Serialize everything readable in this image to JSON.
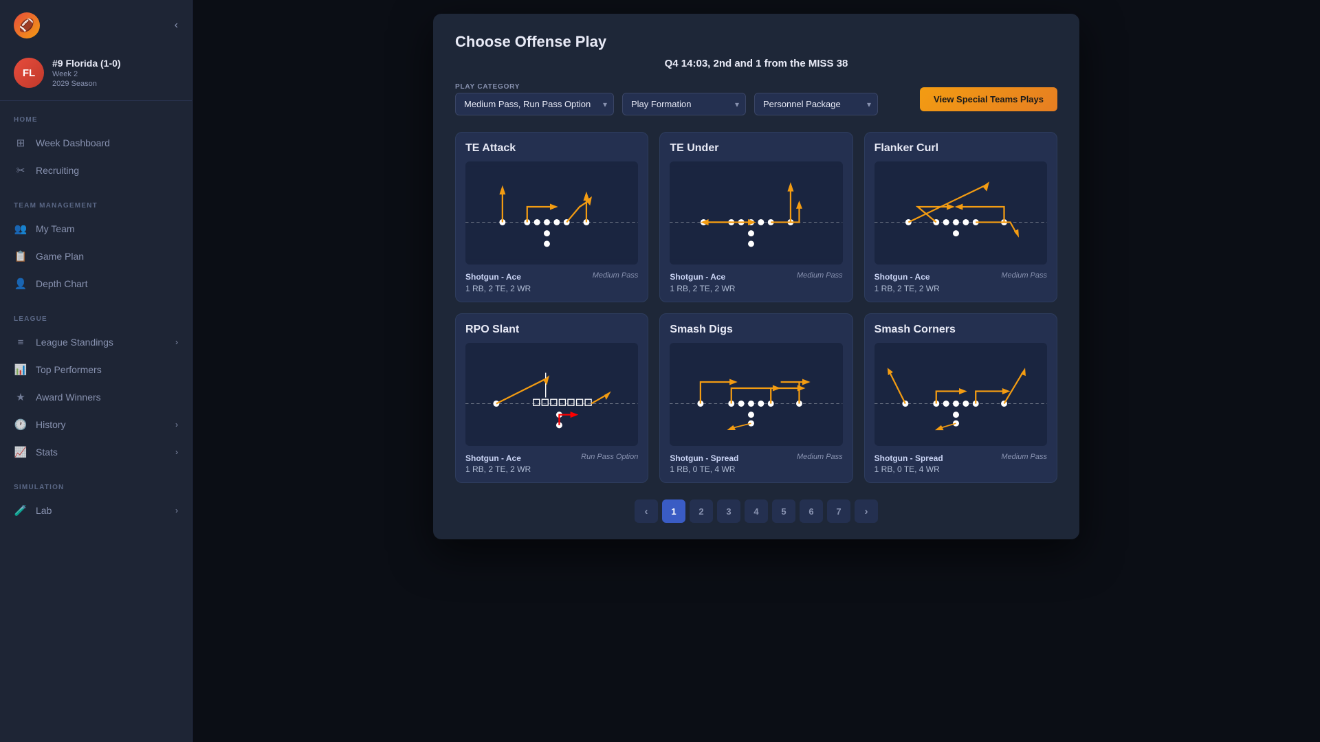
{
  "sidebar": {
    "logo": "🏈",
    "collapse_icon": "‹",
    "team": {
      "initials": "FL",
      "name": "#9 Florida (1-0)",
      "week": "Week 2",
      "season": "2029 Season"
    },
    "sections": [
      {
        "label": "HOME",
        "items": [
          {
            "id": "week-dashboard",
            "label": "Week Dashboard",
            "icon": "⊞",
            "chevron": false
          },
          {
            "id": "recruiting",
            "label": "Recruiting",
            "icon": "✂",
            "chevron": false
          }
        ]
      },
      {
        "label": "TEAM MANAGEMENT",
        "items": [
          {
            "id": "my-team",
            "label": "My Team",
            "icon": "👥",
            "chevron": false
          },
          {
            "id": "game-plan",
            "label": "Game Plan",
            "icon": "📋",
            "chevron": false
          },
          {
            "id": "depth-chart",
            "label": "Depth Chart",
            "icon": "👤",
            "chevron": false
          }
        ]
      },
      {
        "label": "LEAGUE",
        "items": [
          {
            "id": "league-standings",
            "label": "League Standings",
            "icon": "≡",
            "chevron": true
          },
          {
            "id": "top-performers",
            "label": "Top Performers",
            "icon": "📊",
            "chevron": false
          },
          {
            "id": "award-winners",
            "label": "Award Winners",
            "icon": "★",
            "chevron": false
          },
          {
            "id": "history",
            "label": "History",
            "icon": "🕐",
            "chevron": true
          },
          {
            "id": "stats",
            "label": "Stats",
            "icon": "📈",
            "chevron": true
          }
        ]
      },
      {
        "label": "SIMULATION",
        "items": [
          {
            "id": "lab",
            "label": "Lab",
            "icon": "🧪",
            "chevron": true
          }
        ]
      }
    ]
  },
  "modal": {
    "title": "Choose Offense Play",
    "subtitle": "Q4 14:03, 2nd and 1 from the MISS 38",
    "filters": {
      "category_label": "Play Category",
      "category_value": "Medium Pass, Run Pass Option",
      "formation_label": "",
      "formation_placeholder": "Play Formation",
      "personnel_placeholder": "Personnel Package"
    },
    "special_teams_btn": "View Special Teams Plays",
    "plays": [
      {
        "id": "te-attack",
        "title": "TE Attack",
        "formation": "Shotgun - Ace",
        "personnel": "1 RB, 2 TE, 2 WR",
        "type": "Medium Pass",
        "diagram": "te_attack"
      },
      {
        "id": "te-under",
        "title": "TE Under",
        "formation": "Shotgun - Ace",
        "personnel": "1 RB, 2 TE, 2 WR",
        "type": "Medium Pass",
        "diagram": "te_under"
      },
      {
        "id": "flanker-curl",
        "title": "Flanker Curl",
        "formation": "Shotgun - Ace",
        "personnel": "1 RB, 2 TE, 2 WR",
        "type": "Medium Pass",
        "diagram": "flanker_curl"
      },
      {
        "id": "rpo-slant",
        "title": "RPO Slant",
        "formation": "Shotgun - Ace",
        "personnel": "1 RB, 2 TE, 2 WR",
        "type": "Run Pass Option",
        "diagram": "rpo_slant"
      },
      {
        "id": "smash-digs",
        "title": "Smash Digs",
        "formation": "Shotgun - Spread",
        "personnel": "1 RB, 0 TE, 4 WR",
        "type": "Medium Pass",
        "diagram": "smash_digs"
      },
      {
        "id": "smash-corners",
        "title": "Smash Corners",
        "formation": "Shotgun - Spread",
        "personnel": "1 RB, 0 TE, 4 WR",
        "type": "Medium Pass",
        "diagram": "smash_corners"
      }
    ],
    "pagination": {
      "current": 1,
      "total": 7,
      "prev": "‹",
      "next": "›"
    }
  }
}
